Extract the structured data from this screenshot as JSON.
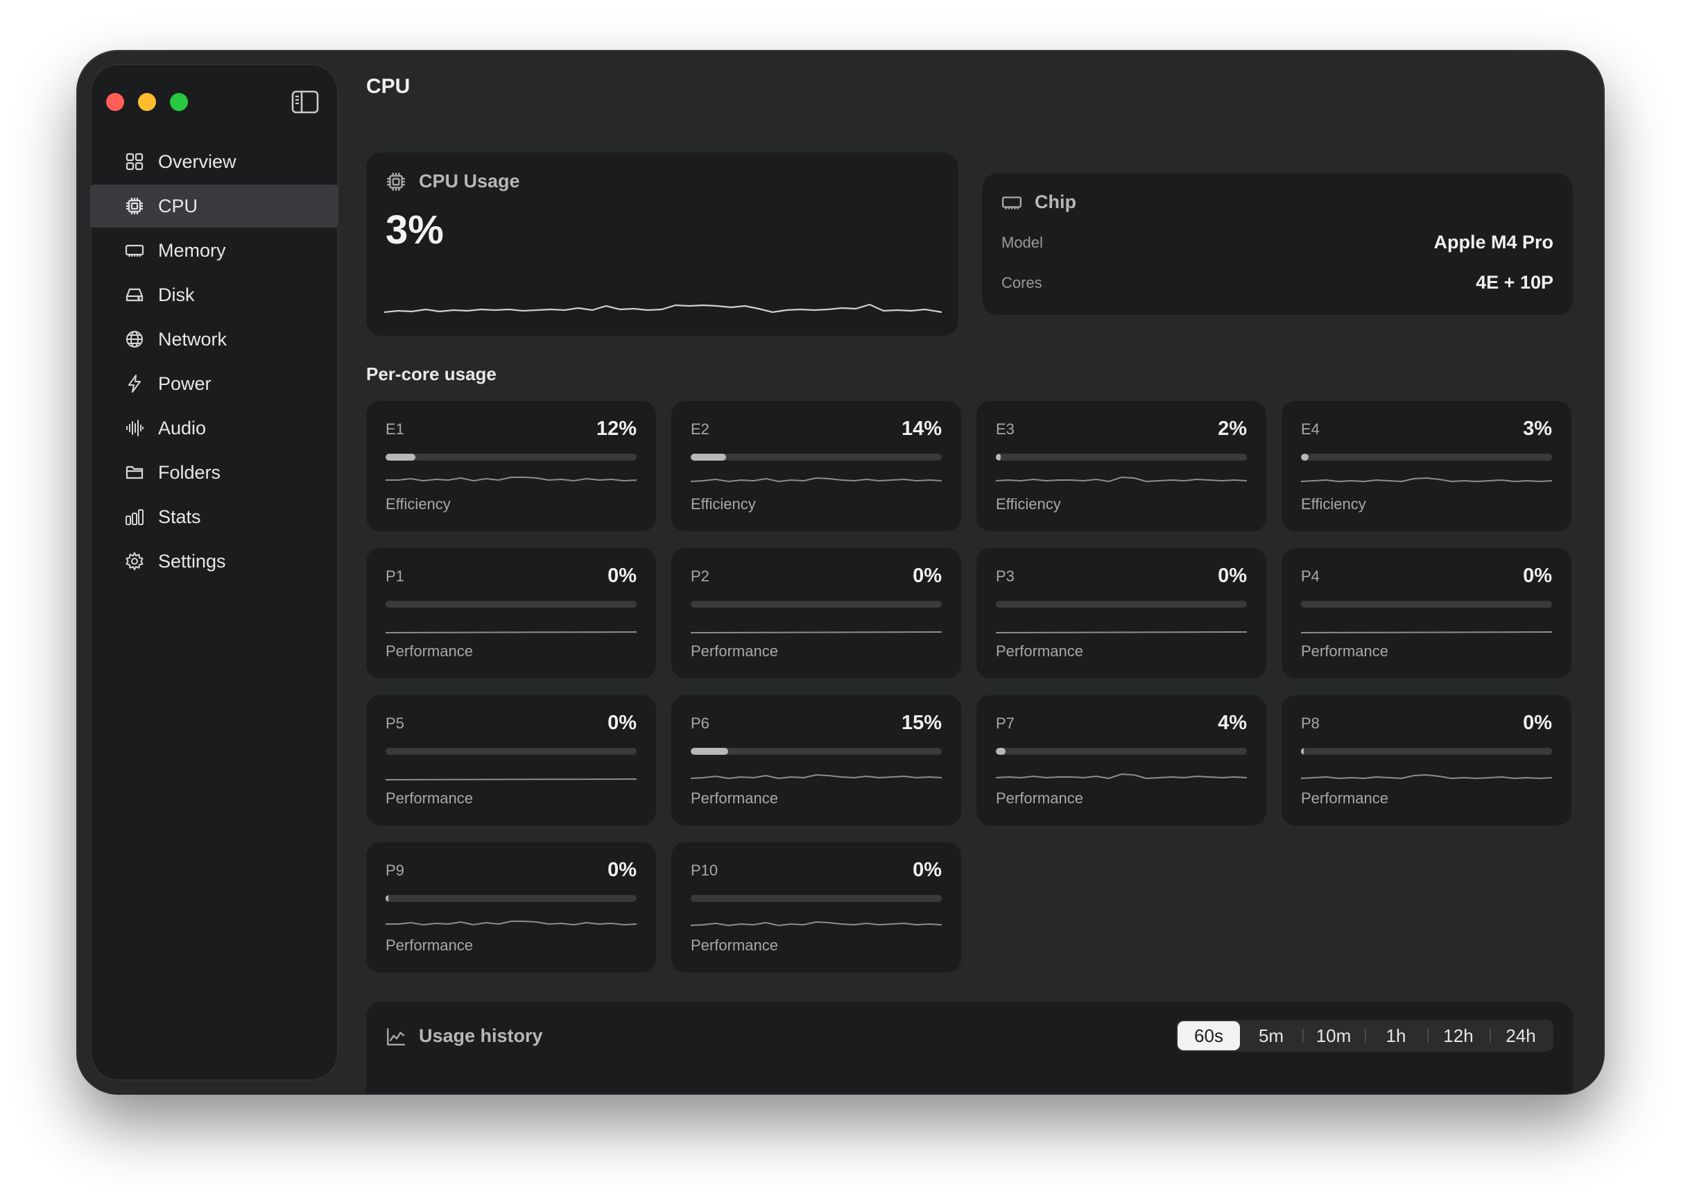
{
  "window": {
    "controls": [
      "close",
      "minimize",
      "zoom"
    ],
    "sidebar_toggle_icon": "sidebar-left-icon"
  },
  "sidebar": {
    "items": [
      {
        "label": "Overview",
        "icon": "grid-icon",
        "active": false
      },
      {
        "label": "CPU",
        "icon": "cpu-icon",
        "active": true
      },
      {
        "label": "Memory",
        "icon": "memory-icon",
        "active": false
      },
      {
        "label": "Disk",
        "icon": "disk-icon",
        "active": false
      },
      {
        "label": "Network",
        "icon": "globe-icon",
        "active": false
      },
      {
        "label": "Power",
        "icon": "bolt-icon",
        "active": false
      },
      {
        "label": "Audio",
        "icon": "waveform-icon",
        "active": false
      },
      {
        "label": "Folders",
        "icon": "folder-icon",
        "active": false
      },
      {
        "label": "Stats",
        "icon": "bar-chart-icon",
        "active": false
      },
      {
        "label": "Settings",
        "icon": "gear-icon",
        "active": false
      }
    ]
  },
  "header": {
    "title": "CPU"
  },
  "usage": {
    "title": "CPU Usage",
    "value": "3%",
    "icon": "cpu-icon"
  },
  "chip": {
    "title": "Chip",
    "icon": "memory-icon",
    "rows": [
      {
        "label": "Model",
        "value": "Apple M4 Pro"
      },
      {
        "label": "Cores",
        "value": "4E + 10P"
      }
    ]
  },
  "per_core": {
    "title": "Per-core usage",
    "cores": [
      {
        "name": "E1",
        "value": "12%",
        "level": 0.12,
        "type": "Efficiency"
      },
      {
        "name": "E2",
        "value": "14%",
        "level": 0.14,
        "type": "Efficiency"
      },
      {
        "name": "E3",
        "value": "2%",
        "level": 0.02,
        "type": "Efficiency"
      },
      {
        "name": "E4",
        "value": "3%",
        "level": 0.03,
        "type": "Efficiency"
      },
      {
        "name": "P1",
        "value": "0%",
        "level": 0,
        "type": "Performance"
      },
      {
        "name": "P2",
        "value": "0%",
        "level": 0,
        "type": "Performance"
      },
      {
        "name": "P3",
        "value": "0%",
        "level": 0,
        "type": "Performance"
      },
      {
        "name": "P4",
        "value": "0%",
        "level": 0,
        "type": "Performance"
      },
      {
        "name": "P5",
        "value": "0%",
        "level": 0,
        "type": "Performance"
      },
      {
        "name": "P6",
        "value": "15%",
        "level": 0.15,
        "type": "Performance"
      },
      {
        "name": "P7",
        "value": "4%",
        "level": 0.04,
        "type": "Performance"
      },
      {
        "name": "P8",
        "value": "0%",
        "level": 0.005,
        "type": "Performance"
      },
      {
        "name": "P9",
        "value": "0%",
        "level": 0.005,
        "type": "Performance"
      },
      {
        "name": "P10",
        "value": "0%",
        "level": 0,
        "type": "Performance"
      }
    ]
  },
  "history": {
    "title": "Usage history",
    "icon": "line-chart-icon",
    "ranges": [
      "60s",
      "5m",
      "10m",
      "1h",
      "12h",
      "24h"
    ],
    "selected": "60s"
  },
  "colors": {
    "background": "#27282a",
    "card": "#1c1c1e",
    "sidebar": "#1b1c1e",
    "text": "#f0f0f2",
    "muted": "#a8a8ac"
  }
}
